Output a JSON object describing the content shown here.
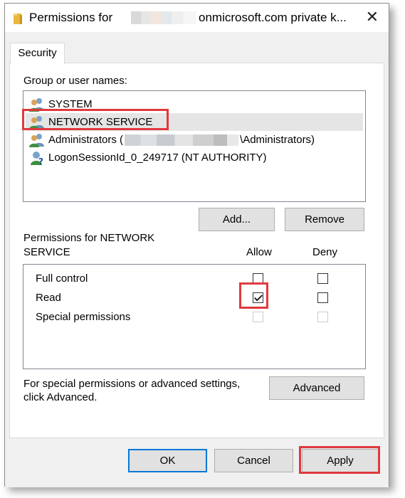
{
  "window": {
    "title_prefix": "Permissions for",
    "title_suffix": "onmicrosoft.com private k...",
    "close_glyph": "✕"
  },
  "tabs": [
    {
      "label": "Security",
      "active": true
    }
  ],
  "group_section": {
    "label": "Group or user names:",
    "items": [
      {
        "text": "SYSTEM",
        "icon": "users-icon"
      },
      {
        "text": "NETWORK SERVICE",
        "icon": "users-icon",
        "selected": true
      },
      {
        "text_before": "Administrators (",
        "text_after": "\\Administrators)",
        "icon": "users-icon"
      },
      {
        "text": "LogonSessionId_0_249717 (NT AUTHORITY)",
        "icon": "unknown-user-icon"
      }
    ],
    "add_label": "Add...",
    "remove_label": "Remove"
  },
  "permissions": {
    "header_line1": "Permissions for NETWORK",
    "header_line2": "SERVICE",
    "allow_label": "Allow",
    "deny_label": "Deny",
    "rows": [
      {
        "name": "Full control",
        "allow": false,
        "deny": false,
        "enabled": true
      },
      {
        "name": "Read",
        "allow": true,
        "deny": false,
        "enabled": true
      },
      {
        "name": "Special permissions",
        "allow": false,
        "deny": false,
        "enabled": false
      }
    ]
  },
  "advanced": {
    "text_line1": "For special permissions or advanced settings,",
    "text_line2": "click Advanced.",
    "button_label": "Advanced"
  },
  "footer": {
    "ok_label": "OK",
    "cancel_label": "Cancel",
    "apply_label": "Apply"
  },
  "colors": {
    "highlight": "#e0393e",
    "dialog_bg": "#f0f0f0",
    "button_bg": "#e1e1e1",
    "default_button_border": "#0078d7"
  }
}
